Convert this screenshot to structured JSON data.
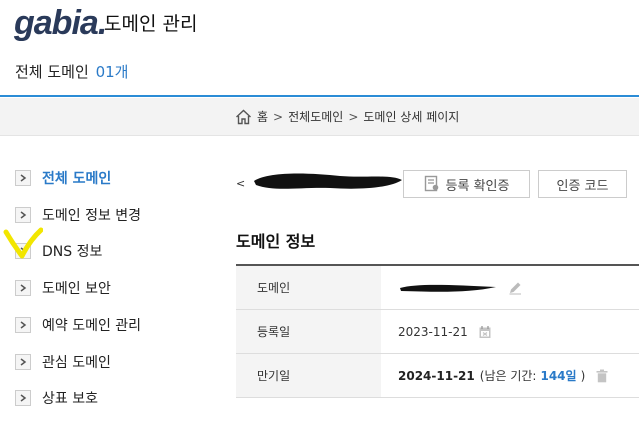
{
  "header": {
    "logo_text": "gabia",
    "logo_dot": ".",
    "title": "도메인 관리",
    "domain_count_label": "전체 도메인",
    "domain_count_value": "01개"
  },
  "breadcrumb": {
    "home": "홈",
    "items": [
      "전체도메인",
      "도메인 상세 페이지"
    ],
    "separator": ">"
  },
  "sidebar": {
    "items": [
      {
        "label": "전체 도메인",
        "active": true
      },
      {
        "label": "도메인 정보 변경"
      },
      {
        "label": "DNS 정보"
      },
      {
        "label": "도메인 보안"
      },
      {
        "label": "예약 도메인 관리"
      },
      {
        "label": "관심 도메인"
      },
      {
        "label": "상표 보호"
      }
    ]
  },
  "main": {
    "back_symbol": "<",
    "buttons": {
      "certificate": "등록 확인증",
      "auth_code": "인증 코드"
    },
    "section_title": "도메인 정보",
    "info": {
      "domain_label": "도메인",
      "registered_label": "등록일",
      "registered_value": "2023-11-21",
      "expiry_label": "만기일",
      "expiry_value": "2024-11-21",
      "remaining_prefix": "(남은 기간:",
      "remaining_days": "144일",
      "remaining_suffix": ")"
    }
  },
  "colors": {
    "accent": "#2a7ac8",
    "header_line": "#2b8cd6",
    "annotation": "#f2e600"
  },
  "icons": [
    "home-icon",
    "chevron-right-icon",
    "certificate-icon",
    "pencil-icon",
    "calendar-icon",
    "trash-icon"
  ]
}
